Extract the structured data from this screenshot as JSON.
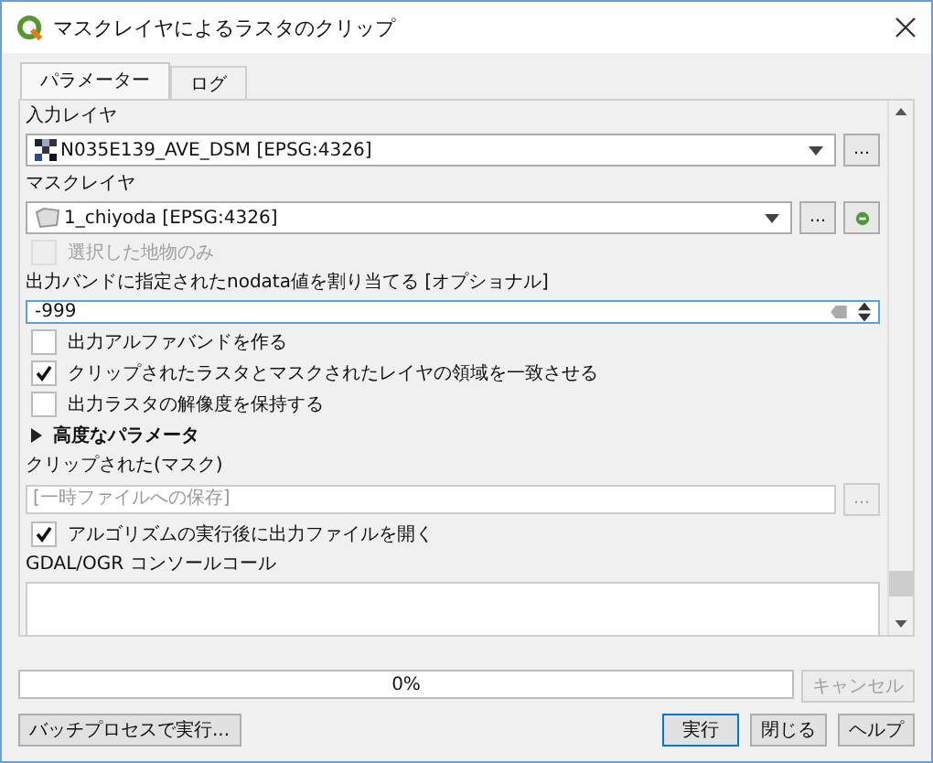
{
  "window": {
    "title": "マスクレイヤによるラスタのクリップ"
  },
  "tabs": [
    {
      "label": "パラメーター",
      "selected": true
    },
    {
      "label": "ログ",
      "selected": false
    }
  ],
  "params": [
    {
      "kind": "label",
      "text": "入力レイヤ"
    },
    {
      "kind": "combo",
      "value": "N035E139_AVE_DSM [EPSG:4326]",
      "layer_icon": {
        "kind": "raster"
      },
      "more": "…",
      "iterate": false
    },
    {
      "kind": "label",
      "text": "マスクレイヤ"
    },
    {
      "kind": "combo",
      "value": "1_chiyoda [EPSG:4326]",
      "layer_icon": {
        "kind": "polygon"
      },
      "more": "…",
      "iterate": true
    },
    {
      "kind": "checkbox",
      "label": "選択した地物のみ",
      "checked": false,
      "disabled": true
    },
    {
      "kind": "label",
      "text": "出力バンドに指定されたnodata値を割り当てる [オプショナル]"
    },
    {
      "kind": "spin",
      "value": "-999"
    },
    {
      "kind": "checkbox",
      "label": "出力アルファバンドを作る",
      "checked": false,
      "disabled": false
    },
    {
      "kind": "checkbox",
      "label": "クリップされたラスタとマスクされたレイヤの領域を一致させる",
      "checked": true,
      "disabled": false
    },
    {
      "kind": "checkbox",
      "label": "出力ラスタの解像度を保持する",
      "checked": false,
      "disabled": false
    },
    {
      "kind": "group",
      "label": "高度なパラメータ",
      "expanded": false
    },
    {
      "kind": "label",
      "text": "クリップされた(マスク)"
    },
    {
      "kind": "file",
      "placeholder": "[一時ファイルへの保存]",
      "more": "…"
    },
    {
      "kind": "checkbox",
      "label": "アルゴリズムの実行後に出力ファイルを開く",
      "checked": true,
      "disabled": false
    },
    {
      "kind": "label",
      "text": "GDAL/OGR コンソールコール"
    },
    {
      "kind": "console"
    }
  ],
  "progress": {
    "level": 0,
    "text": "0%"
  },
  "cancel": {
    "label": "キャンセル",
    "disabled": true
  },
  "batch_button": "バッチプロセスで実行...",
  "buttons": [
    {
      "label": "実行",
      "default": true
    },
    {
      "label": "閉じる",
      "default": false
    },
    {
      "label": "ヘルプ",
      "default": false
    }
  ]
}
